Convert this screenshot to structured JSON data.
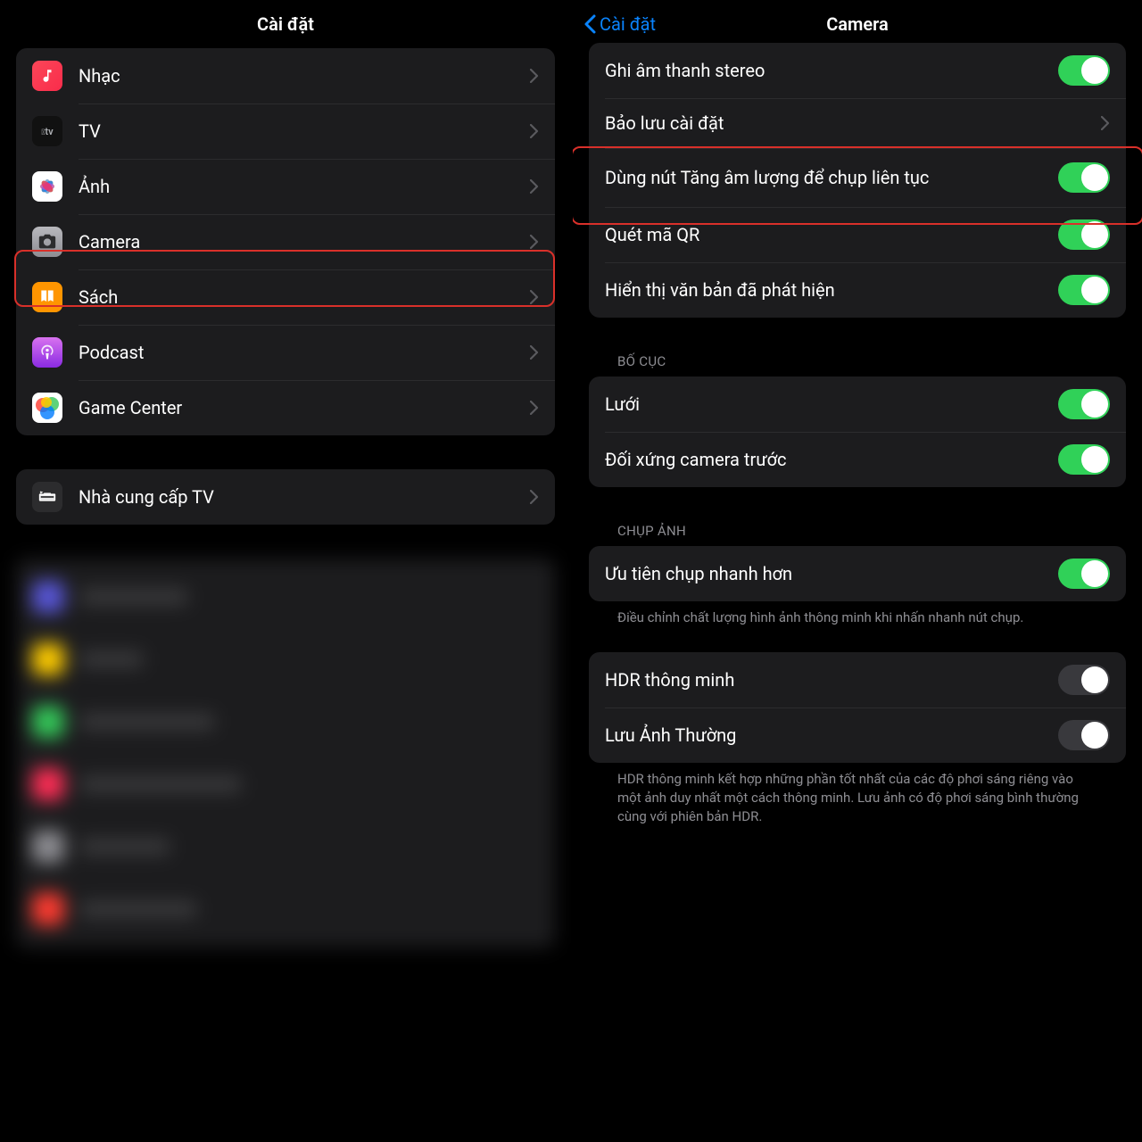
{
  "left": {
    "title": "Cài đặt",
    "group1": [
      {
        "label": "Nhạc",
        "iconName": "music-icon",
        "iconBg": "linear-gradient(135deg,#fb4658,#f92c4b)",
        "iconGlyph": "♪"
      },
      {
        "label": "TV",
        "iconName": "tv-icon",
        "iconBg": "#111",
        "iconGlyph": "tv"
      },
      {
        "label": "Ảnh",
        "iconName": "photos-icon",
        "iconBg": "#fff",
        "iconGlyph": "photos"
      },
      {
        "label": "Camera",
        "iconName": "camera-icon",
        "iconBg": "linear-gradient(#b8b8bd,#8d8d93)",
        "iconGlyph": "camera",
        "highlighted": true
      },
      {
        "label": "Sách",
        "iconName": "books-icon",
        "iconBg": "#ff9500",
        "iconGlyph": "books"
      },
      {
        "label": "Podcast",
        "iconName": "podcast-icon",
        "iconBg": "linear-gradient(#d872ef,#8a2be2)",
        "iconGlyph": "podcast"
      },
      {
        "label": "Game Center",
        "iconName": "gamecenter-icon",
        "iconBg": "#fff",
        "iconGlyph": "gc"
      }
    ],
    "group2": [
      {
        "label": "Nhà cung cấp TV",
        "iconName": "tvprovider-icon",
        "iconBg": "#2c2c2e",
        "iconGlyph": "tvp"
      }
    ]
  },
  "right": {
    "back": "Cài đặt",
    "title": "Camera",
    "group1": [
      {
        "label": "Ghi âm thanh stereo",
        "type": "toggle",
        "on": true
      },
      {
        "label": "Bảo lưu cài đặt",
        "type": "link"
      },
      {
        "label": "Dùng nút Tăng âm lượng để chụp liên tục",
        "type": "toggle",
        "on": true,
        "highlighted": true
      },
      {
        "label": "Quét mã QR",
        "type": "toggle",
        "on": true
      },
      {
        "label": "Hiển thị văn bản đã phát hiện",
        "type": "toggle",
        "on": true
      }
    ],
    "section_layout_header": "BỐ CỤC",
    "group_layout": [
      {
        "label": "Lưới",
        "type": "toggle",
        "on": true
      },
      {
        "label": "Đối xứng camera trước",
        "type": "toggle",
        "on": true
      }
    ],
    "section_capture_header": "CHỤP ẢNH",
    "group_capture1": [
      {
        "label": "Ưu tiên chụp nhanh hơn",
        "type": "toggle",
        "on": true
      }
    ],
    "capture1_footer": "Điều chỉnh chất lượng hình ảnh thông minh khi nhấn nhanh nút chụp.",
    "group_capture2": [
      {
        "label": "HDR thông minh",
        "type": "toggle",
        "on": false
      },
      {
        "label": "Lưu Ảnh Thường",
        "type": "toggle",
        "on": false
      }
    ],
    "capture2_footer": "HDR thông minh kết hợp những phần tốt nhất của các độ phơi sáng riêng vào một ảnh duy nhất một cách thông minh. Lưu ảnh có độ phơi sáng bình thường cùng với phiên bản HDR."
  },
  "colors": {
    "accent": "#0a84ff",
    "toggleOn": "#30d158",
    "highlight": "#d9302a"
  }
}
